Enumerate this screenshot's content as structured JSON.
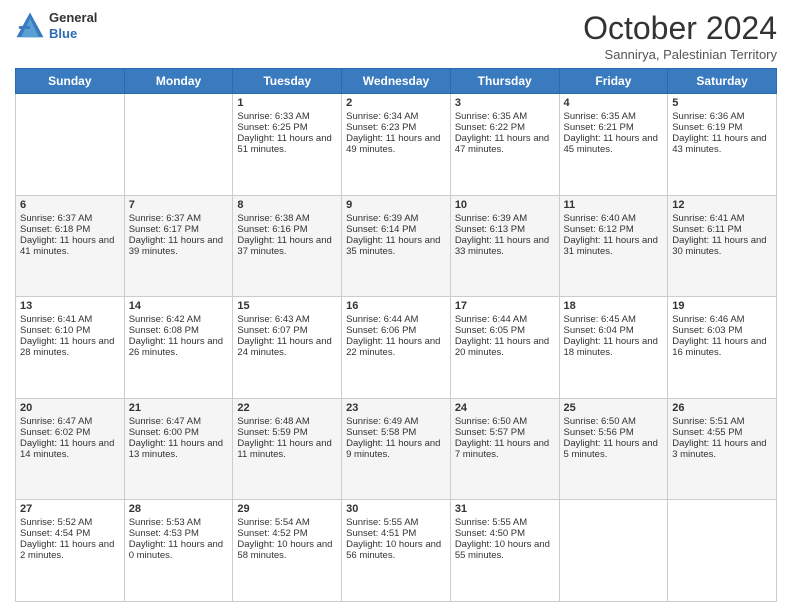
{
  "logo": {
    "line1": "General",
    "line2": "Blue"
  },
  "title": "October 2024",
  "subtitle": "Sannirya, Palestinian Territory",
  "days_of_week": [
    "Sunday",
    "Monday",
    "Tuesday",
    "Wednesday",
    "Thursday",
    "Friday",
    "Saturday"
  ],
  "weeks": [
    [
      {
        "day": "",
        "sunrise": "",
        "sunset": "",
        "daylight": ""
      },
      {
        "day": "",
        "sunrise": "",
        "sunset": "",
        "daylight": ""
      },
      {
        "day": "1",
        "sunrise": "Sunrise: 6:33 AM",
        "sunset": "Sunset: 6:25 PM",
        "daylight": "Daylight: 11 hours and 51 minutes."
      },
      {
        "day": "2",
        "sunrise": "Sunrise: 6:34 AM",
        "sunset": "Sunset: 6:23 PM",
        "daylight": "Daylight: 11 hours and 49 minutes."
      },
      {
        "day": "3",
        "sunrise": "Sunrise: 6:35 AM",
        "sunset": "Sunset: 6:22 PM",
        "daylight": "Daylight: 11 hours and 47 minutes."
      },
      {
        "day": "4",
        "sunrise": "Sunrise: 6:35 AM",
        "sunset": "Sunset: 6:21 PM",
        "daylight": "Daylight: 11 hours and 45 minutes."
      },
      {
        "day": "5",
        "sunrise": "Sunrise: 6:36 AM",
        "sunset": "Sunset: 6:19 PM",
        "daylight": "Daylight: 11 hours and 43 minutes."
      }
    ],
    [
      {
        "day": "6",
        "sunrise": "Sunrise: 6:37 AM",
        "sunset": "Sunset: 6:18 PM",
        "daylight": "Daylight: 11 hours and 41 minutes."
      },
      {
        "day": "7",
        "sunrise": "Sunrise: 6:37 AM",
        "sunset": "Sunset: 6:17 PM",
        "daylight": "Daylight: 11 hours and 39 minutes."
      },
      {
        "day": "8",
        "sunrise": "Sunrise: 6:38 AM",
        "sunset": "Sunset: 6:16 PM",
        "daylight": "Daylight: 11 hours and 37 minutes."
      },
      {
        "day": "9",
        "sunrise": "Sunrise: 6:39 AM",
        "sunset": "Sunset: 6:14 PM",
        "daylight": "Daylight: 11 hours and 35 minutes."
      },
      {
        "day": "10",
        "sunrise": "Sunrise: 6:39 AM",
        "sunset": "Sunset: 6:13 PM",
        "daylight": "Daylight: 11 hours and 33 minutes."
      },
      {
        "day": "11",
        "sunrise": "Sunrise: 6:40 AM",
        "sunset": "Sunset: 6:12 PM",
        "daylight": "Daylight: 11 hours and 31 minutes."
      },
      {
        "day": "12",
        "sunrise": "Sunrise: 6:41 AM",
        "sunset": "Sunset: 6:11 PM",
        "daylight": "Daylight: 11 hours and 30 minutes."
      }
    ],
    [
      {
        "day": "13",
        "sunrise": "Sunrise: 6:41 AM",
        "sunset": "Sunset: 6:10 PM",
        "daylight": "Daylight: 11 hours and 28 minutes."
      },
      {
        "day": "14",
        "sunrise": "Sunrise: 6:42 AM",
        "sunset": "Sunset: 6:08 PM",
        "daylight": "Daylight: 11 hours and 26 minutes."
      },
      {
        "day": "15",
        "sunrise": "Sunrise: 6:43 AM",
        "sunset": "Sunset: 6:07 PM",
        "daylight": "Daylight: 11 hours and 24 minutes."
      },
      {
        "day": "16",
        "sunrise": "Sunrise: 6:44 AM",
        "sunset": "Sunset: 6:06 PM",
        "daylight": "Daylight: 11 hours and 22 minutes."
      },
      {
        "day": "17",
        "sunrise": "Sunrise: 6:44 AM",
        "sunset": "Sunset: 6:05 PM",
        "daylight": "Daylight: 11 hours and 20 minutes."
      },
      {
        "day": "18",
        "sunrise": "Sunrise: 6:45 AM",
        "sunset": "Sunset: 6:04 PM",
        "daylight": "Daylight: 11 hours and 18 minutes."
      },
      {
        "day": "19",
        "sunrise": "Sunrise: 6:46 AM",
        "sunset": "Sunset: 6:03 PM",
        "daylight": "Daylight: 11 hours and 16 minutes."
      }
    ],
    [
      {
        "day": "20",
        "sunrise": "Sunrise: 6:47 AM",
        "sunset": "Sunset: 6:02 PM",
        "daylight": "Daylight: 11 hours and 14 minutes."
      },
      {
        "day": "21",
        "sunrise": "Sunrise: 6:47 AM",
        "sunset": "Sunset: 6:00 PM",
        "daylight": "Daylight: 11 hours and 13 minutes."
      },
      {
        "day": "22",
        "sunrise": "Sunrise: 6:48 AM",
        "sunset": "Sunset: 5:59 PM",
        "daylight": "Daylight: 11 hours and 11 minutes."
      },
      {
        "day": "23",
        "sunrise": "Sunrise: 6:49 AM",
        "sunset": "Sunset: 5:58 PM",
        "daylight": "Daylight: 11 hours and 9 minutes."
      },
      {
        "day": "24",
        "sunrise": "Sunrise: 6:50 AM",
        "sunset": "Sunset: 5:57 PM",
        "daylight": "Daylight: 11 hours and 7 minutes."
      },
      {
        "day": "25",
        "sunrise": "Sunrise: 6:50 AM",
        "sunset": "Sunset: 5:56 PM",
        "daylight": "Daylight: 11 hours and 5 minutes."
      },
      {
        "day": "26",
        "sunrise": "Sunrise: 5:51 AM",
        "sunset": "Sunset: 4:55 PM",
        "daylight": "Daylight: 11 hours and 3 minutes."
      }
    ],
    [
      {
        "day": "27",
        "sunrise": "Sunrise: 5:52 AM",
        "sunset": "Sunset: 4:54 PM",
        "daylight": "Daylight: 11 hours and 2 minutes."
      },
      {
        "day": "28",
        "sunrise": "Sunrise: 5:53 AM",
        "sunset": "Sunset: 4:53 PM",
        "daylight": "Daylight: 11 hours and 0 minutes."
      },
      {
        "day": "29",
        "sunrise": "Sunrise: 5:54 AM",
        "sunset": "Sunset: 4:52 PM",
        "daylight": "Daylight: 10 hours and 58 minutes."
      },
      {
        "day": "30",
        "sunrise": "Sunrise: 5:55 AM",
        "sunset": "Sunset: 4:51 PM",
        "daylight": "Daylight: 10 hours and 56 minutes."
      },
      {
        "day": "31",
        "sunrise": "Sunrise: 5:55 AM",
        "sunset": "Sunset: 4:50 PM",
        "daylight": "Daylight: 10 hours and 55 minutes."
      },
      {
        "day": "",
        "sunrise": "",
        "sunset": "",
        "daylight": ""
      },
      {
        "day": "",
        "sunrise": "",
        "sunset": "",
        "daylight": ""
      }
    ]
  ]
}
